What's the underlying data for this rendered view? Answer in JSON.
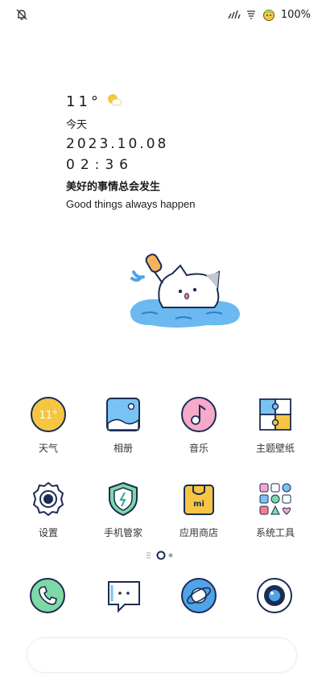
{
  "status_bar": {
    "left_icon": "notifications-off-icon",
    "right_icons": [
      "signal-icon",
      "wifi-icon",
      "battery-character-icon"
    ],
    "battery_text": "100%"
  },
  "widget": {
    "temperature": "11°",
    "weather_icon": "sunny-cloud-icon",
    "day_label": "今天",
    "date": "2023.10.08",
    "time": "02:36",
    "motto_cn": "美好的事情总会发生",
    "motto_en": "Good things always happen"
  },
  "apps": [
    {
      "label": "天气",
      "icon": "weather-icon",
      "icon_text": "11°"
    },
    {
      "label": "相册",
      "icon": "gallery-icon"
    },
    {
      "label": "音乐",
      "icon": "music-icon"
    },
    {
      "label": "主题壁纸",
      "icon": "themes-icon"
    },
    {
      "label": "设置",
      "icon": "settings-icon"
    },
    {
      "label": "手机管家",
      "icon": "security-icon"
    },
    {
      "label": "应用商店",
      "icon": "app-store-icon",
      "icon_text": "mi"
    },
    {
      "label": "系统工具",
      "icon": "tools-folder-icon"
    }
  ],
  "pager": {
    "current_page": 1,
    "page_count": 2
  },
  "dock": [
    "phone-icon",
    "messages-icon",
    "browser-icon",
    "camera-icon"
  ],
  "colors": {
    "yellow": "#F6C642",
    "blue": "#4FA3E8",
    "pink": "#F6A9C9",
    "green": "#7ED9A6",
    "outline": "#1B2C52"
  }
}
